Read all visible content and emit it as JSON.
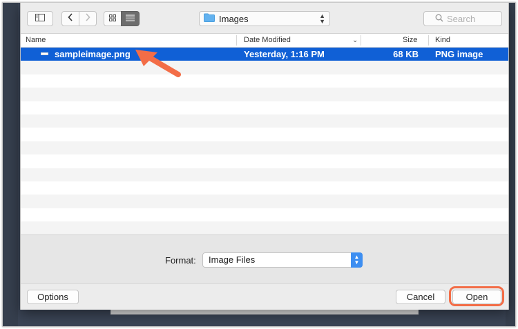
{
  "toolbar": {
    "location": "Images",
    "search_placeholder": "Search"
  },
  "columns": {
    "name": "Name",
    "date_modified": "Date Modified",
    "size": "Size",
    "kind": "Kind"
  },
  "files": [
    {
      "name": "sampleimage.png",
      "date_modified": "Yesterday, 1:16 PM",
      "size": "68 KB",
      "kind": "PNG image",
      "selected": true
    }
  ],
  "empty_rows": 14,
  "format": {
    "label": "Format:",
    "value": "Image Files"
  },
  "buttons": {
    "options": "Options",
    "cancel": "Cancel",
    "open": "Open"
  },
  "colors": {
    "selection": "#1060d6",
    "annotation": "#f36d47",
    "accent": "#3d8ef1"
  },
  "icons": {
    "sidebar_toggle": "sidebar-toggle-icon",
    "back": "chevron-left-icon",
    "forward": "chevron-right-icon",
    "icon_view": "grid-view-icon",
    "list_view": "list-view-icon",
    "folder": "folder-icon",
    "search": "search-icon",
    "file": "file-icon"
  }
}
